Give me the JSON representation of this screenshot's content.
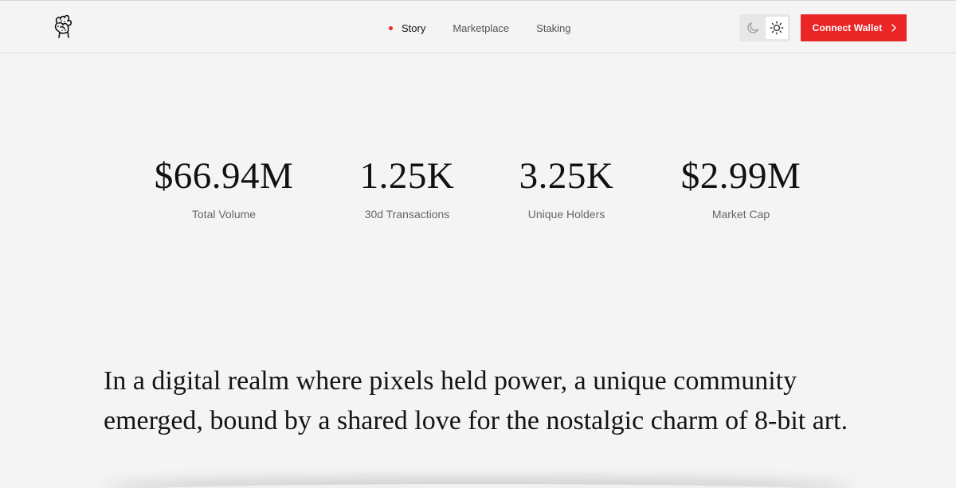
{
  "header": {
    "logo_icon": "fist-logo-icon",
    "nav": [
      {
        "label": "Story",
        "active": true
      },
      {
        "label": "Marketplace",
        "active": false
      },
      {
        "label": "Staking",
        "active": false
      }
    ],
    "theme_toggle": {
      "dark_icon": "moon-icon",
      "light_icon": "sun-icon",
      "selected": "light"
    },
    "connect_wallet": {
      "label": "Connect Wallet",
      "icon": "chevron-right-icon",
      "color": "#ea2525"
    },
    "accent_color": "#ef2a2a"
  },
  "stats": [
    {
      "value": "$66.94M",
      "label": "Total Volume"
    },
    {
      "value": "1.25K",
      "label": "30d Transactions"
    },
    {
      "value": "3.25K",
      "label": "Unique Holders"
    },
    {
      "value": "$2.99M",
      "label": "Market Cap"
    }
  ],
  "story": {
    "text": "In a digital realm where pixels held power, a unique community emerged, bound by a shared love for the nostalgic charm of 8-bit art."
  }
}
